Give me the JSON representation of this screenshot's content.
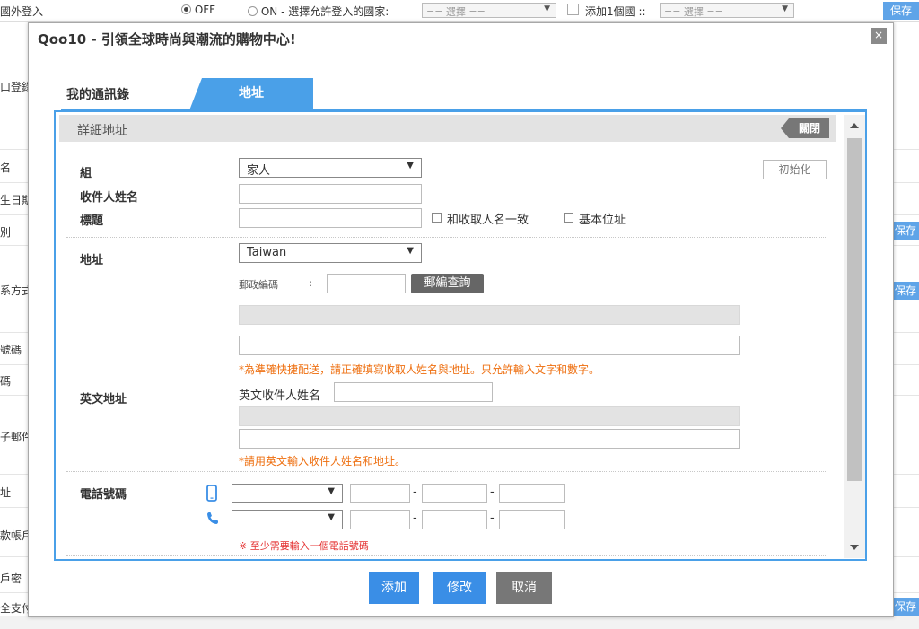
{
  "background": {
    "top_bar": {
      "label": "國外登入",
      "off_label": "OFF",
      "on_label": "ON - 選擇允許登入的國家:",
      "select1": "== 選擇 ==",
      "add_one_label": "添加1個國 ::",
      "select2": "== 選擇 ==",
      "save_label": "保存"
    },
    "row_labels": [
      "口登錄",
      "名",
      "生日期",
      "別",
      "系方式",
      "號碼",
      "碼",
      "子郵件",
      "址",
      "款帳戶",
      "戶密",
      "全支付"
    ],
    "save_labels": [
      "保存",
      "保存",
      "保存"
    ]
  },
  "modal": {
    "title": "Qoo10 - 引領全球時尚與潮流的購物中心!",
    "close_symbol": "×",
    "tabs": {
      "contacts": "我的通訊錄",
      "address": "地址"
    },
    "panel": {
      "heading": "詳細地址",
      "close_label": "關閉",
      "reset_label": "初始化",
      "group_label": "組",
      "group_value": "家人",
      "recipient_label": "收件人姓名",
      "recipient_value": "",
      "title_label": "標題",
      "title_value": "",
      "same_as_recipient_label": "和收取人名一致",
      "default_address_label": "基本位址",
      "address_label": "地址",
      "country_value": "Taiwan",
      "zip_label": "郵政編碼",
      "zip_colon": ":",
      "zip_value": "",
      "zip_search_label": "郵編查詢",
      "address_note": "*為準確快捷配送，請正確填寫收取人姓名與地址。只允許輸入文字和數字。",
      "en_address_label": "英文地址",
      "en_recipient_label": "英文收件人姓名",
      "en_note": "*請用英文輸入收件人姓名和地址。",
      "phone_label": "電話號碼",
      "phone_dash": "-",
      "phone_note": "※ 至少需要輸入一個電話號碼"
    },
    "buttons": {
      "add": "添加",
      "edit": "修改",
      "cancel": "取消"
    }
  },
  "colors": {
    "accent": "#4aa0e8",
    "button_blue": "#3a8ee6",
    "button_gray": "#777777",
    "warning": "#ee6f10"
  }
}
